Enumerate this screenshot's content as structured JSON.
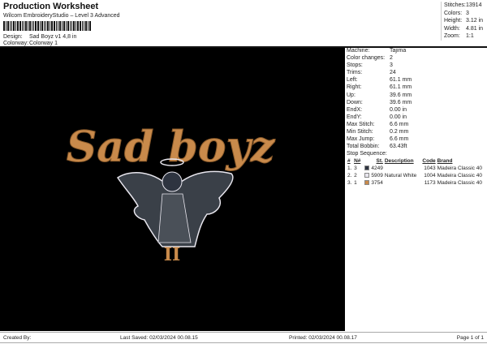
{
  "header": {
    "title": "Production Worksheet",
    "subtitle": "Wilcom EmbroideryStudio – Level 3 Advanced",
    "design_label": "Design:",
    "design_value": "Sad Boyz v1 4,8 in",
    "colorway_label": "Colorway:",
    "colorway_value": "Colorway 1"
  },
  "stats": [
    {
      "k": "Stitches:",
      "v": "13914"
    },
    {
      "k": "Colors:",
      "v": "3"
    },
    {
      "k": "Height:",
      "v": "3.12 in"
    },
    {
      "k": "Width:",
      "v": "4.81 in"
    },
    {
      "k": "Zoom:",
      "v": "1:1"
    }
  ],
  "design": {
    "text_top": "Sad boyz",
    "text_bottom": "II",
    "thread_gold": "#c98a4b",
    "thread_dark": "#2e3440",
    "thread_white": "#e8e6ee"
  },
  "machine": [
    {
      "k": "Machine:",
      "v": "Tajima"
    },
    {
      "k": "Color changes:",
      "v": "2"
    },
    {
      "k": "Stops:",
      "v": "3"
    },
    {
      "k": "Trims:",
      "v": "24"
    },
    {
      "k": "Left:",
      "v": "61.1 mm"
    },
    {
      "k": "Right:",
      "v": "61.1 mm"
    },
    {
      "k": "Up:",
      "v": "39.6 mm"
    },
    {
      "k": "Down:",
      "v": "39.6 mm"
    },
    {
      "k": "EndX:",
      "v": "0.00 in"
    },
    {
      "k": "EndY:",
      "v": "0.00 in"
    },
    {
      "k": "Max Stitch:",
      "v": "6.6 mm"
    },
    {
      "k": "Min Stitch:",
      "v": "0.2 mm"
    },
    {
      "k": "Max Jump:",
      "v": "6.6 mm"
    },
    {
      "k": "Total Bobbin:",
      "v": "63.43ft"
    }
  ],
  "stop_sequence": {
    "label": "Stop Sequence:",
    "columns": [
      "#",
      "N#",
      "St.",
      "Description",
      "Code",
      "Brand"
    ],
    "rows": [
      {
        "n": "1.",
        "num": "3",
        "color": "#2e3440",
        "st": "4249",
        "desc": "",
        "code": "1043",
        "brand": "Madeira Classic 40"
      },
      {
        "n": "2.",
        "num": "2",
        "color": "#e8e6ee",
        "st": "5909",
        "desc": "Natural White",
        "code": "1004",
        "brand": "Madeira Classic 40"
      },
      {
        "n": "3.",
        "num": "1",
        "color": "#c98a4b",
        "st": "3754",
        "desc": "",
        "code": "1173",
        "brand": "Madeira Classic 40"
      }
    ]
  },
  "footer": {
    "created": "Created By:",
    "saved": "Last Saved: 02/03/2024 00.08.15",
    "printed": "Printed: 02/03/2024 00.08.17",
    "page": "Page 1 of 1"
  }
}
